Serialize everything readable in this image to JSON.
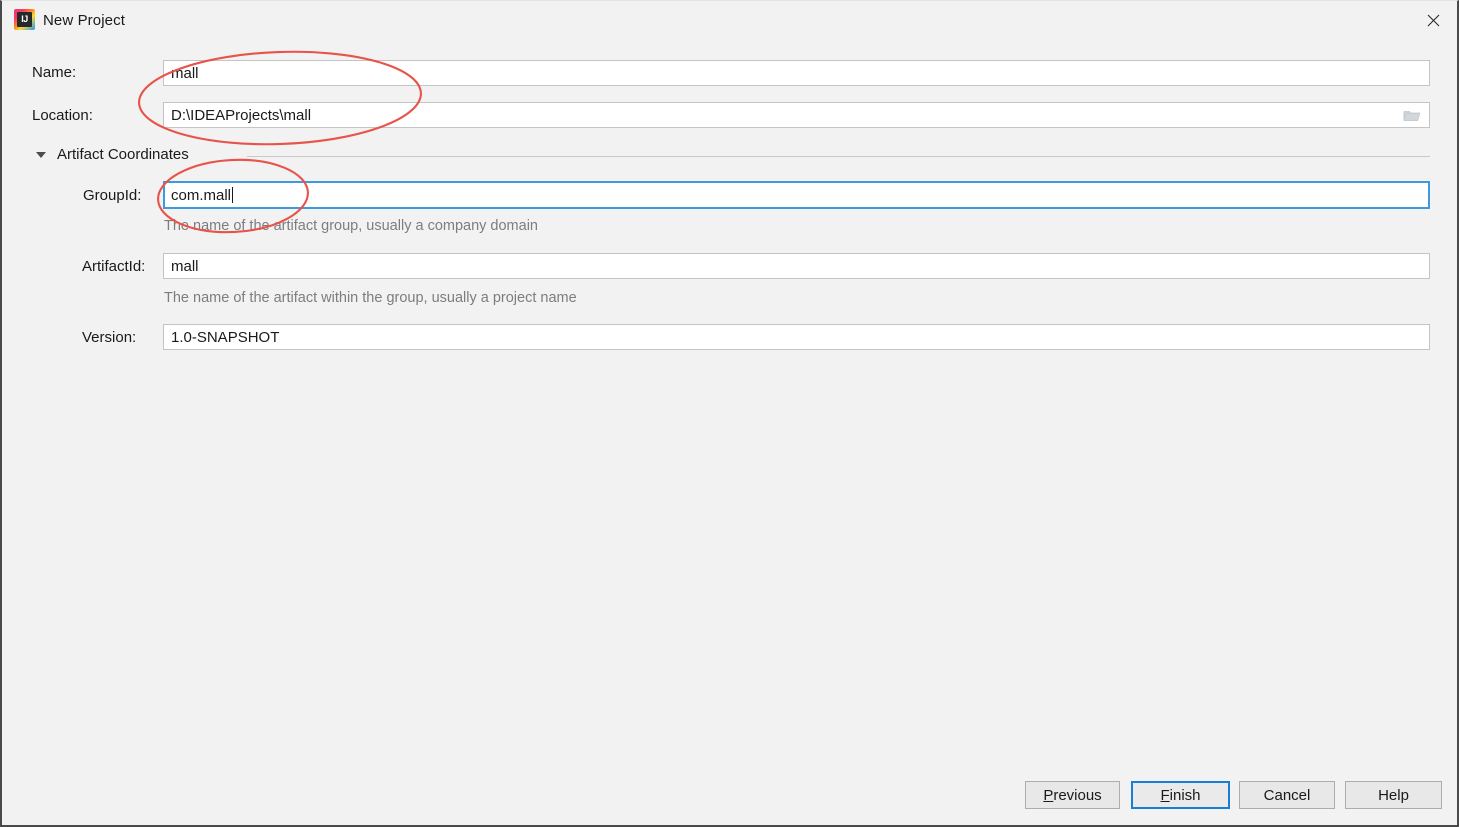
{
  "window": {
    "title": "New Project",
    "app_icon": "intellij-idea-icon",
    "icon_text": "IJ",
    "close_icon": "close-icon"
  },
  "form": {
    "name": {
      "label": "Name:",
      "value": "mall",
      "placeholder": ""
    },
    "location": {
      "label": "Location:",
      "value": "D:\\IDEAProjects\\mall",
      "placeholder": "",
      "browse_icon": "folder-icon"
    },
    "section": {
      "label": "Artifact Coordinates",
      "expanded": true,
      "triangle_icon": "chevron-down-icon"
    },
    "group_id": {
      "label": "GroupId:",
      "value": "com.mall",
      "placeholder": "",
      "hint": "The name of the artifact group, usually a company domain",
      "focused": true
    },
    "artifact_id": {
      "label": "ArtifactId:",
      "value": "mall",
      "placeholder": "",
      "hint": "The name of the artifact within the group, usually a project name"
    },
    "version": {
      "label": "Version:",
      "value": "1.0-SNAPSHOT",
      "placeholder": ""
    }
  },
  "buttons": {
    "previous": {
      "label": "Previous",
      "mnemonic": "P",
      "rest": "revious"
    },
    "finish": {
      "label": "Finish",
      "mnemonic": "F",
      "rest": "inish",
      "is_default": true
    },
    "cancel": {
      "label": "Cancel"
    },
    "help": {
      "label": "Help"
    }
  },
  "annotations": {
    "color": "#e8534a",
    "shapes": [
      {
        "name": "ellipse-name-location"
      },
      {
        "name": "ellipse-groupid"
      }
    ]
  },
  "colors": {
    "dialog_background": "#f2f2f2",
    "field_background": "#ffffff",
    "field_border": "#c4c4c4",
    "focus_blue": "#3d9ae0",
    "default_button_blue": "#1a7fd4",
    "hint_text": "#7d7d7d",
    "text": "#1a1a1a",
    "annotation_red": "#e8534a"
  }
}
